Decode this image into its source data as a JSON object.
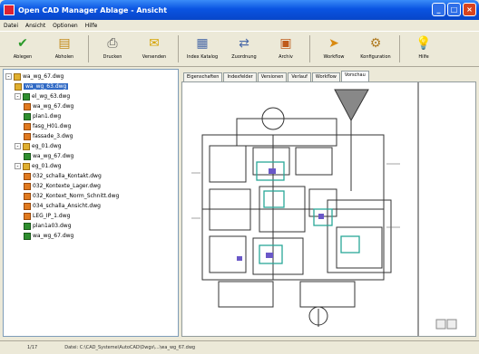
{
  "window": {
    "title": "Open CAD Manager Ablage - Ansicht"
  },
  "menu": [
    "Datei",
    "Ansicht",
    "Optionen",
    "Hilfe"
  ],
  "toolbar": [
    {
      "label": "Ablegen",
      "icon": "check-icon"
    },
    {
      "label": "Abholen",
      "icon": "document-stack-icon"
    },
    {
      "label": "Drucken",
      "icon": "print-icon"
    },
    {
      "label": "Versenden",
      "icon": "envelope-icon"
    },
    {
      "label": "Index Katalog",
      "icon": "catalog-icon"
    },
    {
      "label": "Zuordnung",
      "icon": "assign-icon"
    },
    {
      "label": "Archiv",
      "icon": "archive-icon"
    },
    {
      "label": "Workflow",
      "icon": "workflow-icon"
    },
    {
      "label": "Konfiguration",
      "icon": "config-icon"
    },
    {
      "label": "Hilfe",
      "icon": "help-bulb-icon"
    }
  ],
  "tree": [
    {
      "label": "wa_wg_67.dwg",
      "level": 0,
      "kind": "f",
      "expander": "-"
    },
    {
      "label": "wa_wg_63.dwg",
      "level": 1,
      "kind": "f",
      "selected": true
    },
    {
      "label": "el_wg_63.dwg",
      "level": 1,
      "kind": "d",
      "expander": "-"
    },
    {
      "label": "wa_wg_67.dwg",
      "level": 2,
      "kind": "o"
    },
    {
      "label": "plan1.dwg",
      "level": 2,
      "kind": "d"
    },
    {
      "label": "fasg_H01.dwg",
      "level": 2,
      "kind": "o"
    },
    {
      "label": "fassade_3.dwg",
      "level": 2,
      "kind": "o"
    },
    {
      "label": "eg_01.dwg",
      "level": 1,
      "kind": "f",
      "expander": "-"
    },
    {
      "label": "wa_wg_67.dwg",
      "level": 2,
      "kind": "d"
    },
    {
      "label": "eg_01.dwg",
      "level": 1,
      "kind": "f",
      "expander": "-"
    },
    {
      "label": "032_schalla_Kontakt.dwg",
      "level": 2,
      "kind": "o"
    },
    {
      "label": "032_Kontexte_Lager.dwg",
      "level": 2,
      "kind": "o"
    },
    {
      "label": "032_Kontext_Norm_Schnitt.dwg",
      "level": 2,
      "kind": "o"
    },
    {
      "label": "034_schalla_Ansicht.dwg",
      "level": 2,
      "kind": "o"
    },
    {
      "label": "LEG_IP_1.dwg",
      "level": 2,
      "kind": "o"
    },
    {
      "label": "plan1a03.dwg",
      "level": 2,
      "kind": "d"
    },
    {
      "label": "wa_wg_67.dwg",
      "level": 2,
      "kind": "d"
    }
  ],
  "tabs": [
    {
      "label": "Eigenschaften",
      "active": false
    },
    {
      "label": "Indexfelder",
      "active": false
    },
    {
      "label": "Versionen",
      "active": false
    },
    {
      "label": "Verlauf",
      "active": false
    },
    {
      "label": "Workflow",
      "active": false
    },
    {
      "label": "Vorschau",
      "active": true
    }
  ],
  "status": {
    "count": "1/17",
    "path": "Datei: C:\\CAD_Systeme\\AutoCAD\\Dwgs\\...\\wa_wg_67.dwg"
  },
  "colors": {
    "title": "#0a54e2",
    "selection": "#316ac5",
    "plan_accent": "#28a898",
    "plan_walls": "#333333"
  }
}
